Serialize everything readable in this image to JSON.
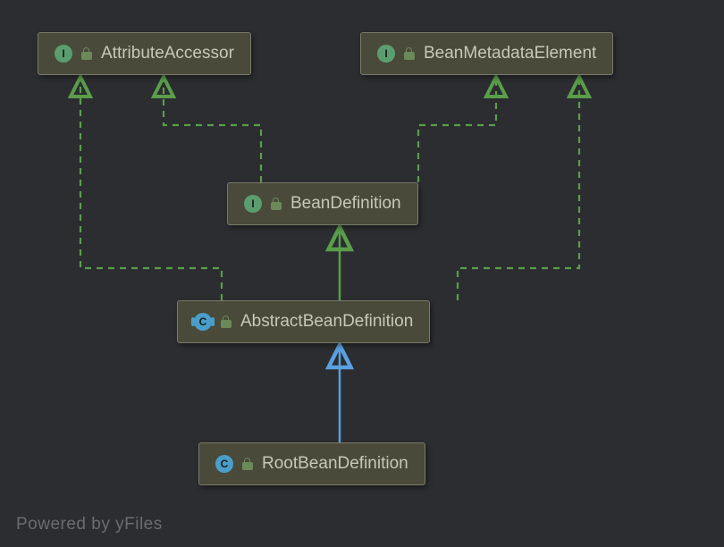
{
  "footer": "Powered by yFiles",
  "nodes": {
    "attributeAccessor": {
      "label": "AttributeAccessor",
      "kind": "I"
    },
    "beanMetadataElement": {
      "label": "BeanMetadataElement",
      "kind": "I"
    },
    "beanDefinition": {
      "label": "BeanDefinition",
      "kind": "I"
    },
    "abstractBeanDefinition": {
      "label": "AbstractBeanDefinition",
      "kind": "C"
    },
    "rootBeanDefinition": {
      "label": "RootBeanDefinition",
      "kind": "C"
    }
  },
  "chart_data": {
    "type": "diagram",
    "title": "",
    "nodes": [
      {
        "id": "AttributeAccessor",
        "kind": "interface"
      },
      {
        "id": "BeanMetadataElement",
        "kind": "interface"
      },
      {
        "id": "BeanDefinition",
        "kind": "interface"
      },
      {
        "id": "AbstractBeanDefinition",
        "kind": "abstract-class"
      },
      {
        "id": "RootBeanDefinition",
        "kind": "class"
      }
    ],
    "edges": [
      {
        "from": "BeanDefinition",
        "to": "AttributeAccessor",
        "relation": "extends-interface",
        "style": "dashed-green"
      },
      {
        "from": "BeanDefinition",
        "to": "BeanMetadataElement",
        "relation": "extends-interface",
        "style": "dashed-green"
      },
      {
        "from": "AbstractBeanDefinition",
        "to": "BeanDefinition",
        "relation": "implements",
        "style": "solid-green"
      },
      {
        "from": "AbstractBeanDefinition",
        "to": "AttributeAccessor",
        "relation": "implements",
        "style": "dashed-green"
      },
      {
        "from": "AbstractBeanDefinition",
        "to": "BeanMetadataElement",
        "relation": "implements",
        "style": "dashed-green"
      },
      {
        "from": "RootBeanDefinition",
        "to": "AbstractBeanDefinition",
        "relation": "extends-class",
        "style": "solid-blue"
      }
    ]
  }
}
